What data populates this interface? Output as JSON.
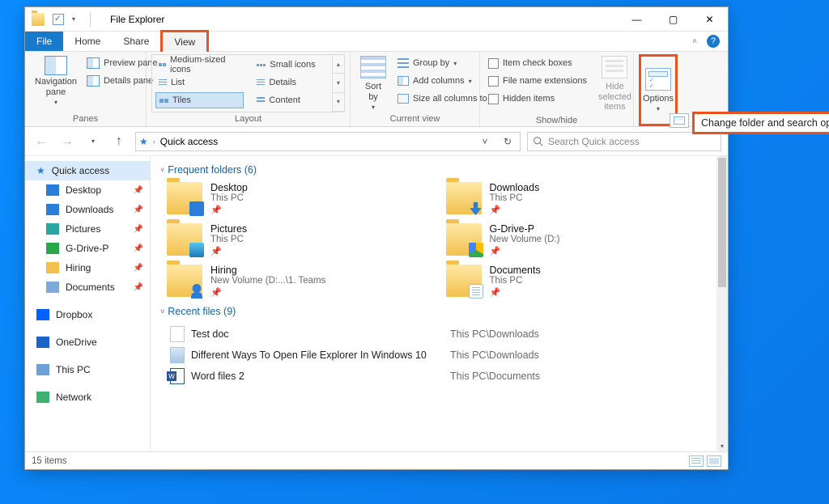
{
  "window": {
    "title": "File Explorer"
  },
  "win_controls": {
    "min": "—",
    "max": "▢",
    "close": "✕"
  },
  "tabs": {
    "file": "File",
    "home": "Home",
    "share": "Share",
    "view": "View"
  },
  "ribbon": {
    "panes": {
      "nav": "Navigation\npane",
      "preview": "Preview pane",
      "details": "Details pane",
      "label": "Panes"
    },
    "layout": {
      "medium": "Medium-sized icons",
      "small": "Small icons",
      "list": "List",
      "details": "Details",
      "tiles": "Tiles",
      "content": "Content",
      "label": "Layout"
    },
    "curview": {
      "sort": "Sort\nby",
      "group": "Group by",
      "addcols": "Add columns",
      "sizecols": "Size all columns to fit",
      "label": "Current view"
    },
    "showhide": {
      "checkboxes": "Item check boxes",
      "ext": "File name extensions",
      "hidden": "Hidden items",
      "hidebtn": "Hide selected\nitems",
      "label": "Show/hide"
    },
    "options": "Options"
  },
  "callout": "Change folder and search options",
  "address": {
    "crumb": "Quick access"
  },
  "search": {
    "placeholder": "Search Quick access"
  },
  "nav": {
    "quick": "Quick access",
    "desktop": "Desktop",
    "downloads": "Downloads",
    "pictures": "Pictures",
    "gdrive": "G-Drive-P",
    "hiring": "Hiring",
    "documents": "Documents",
    "dropbox": "Dropbox",
    "onedrive": "OneDrive",
    "thispc": "This PC",
    "network": "Network"
  },
  "sections": {
    "freq": "Frequent folders (6)",
    "recent": "Recent files (9)"
  },
  "freq": [
    {
      "name": "Desktop",
      "loc": "This PC",
      "ov": "desktop"
    },
    {
      "name": "Downloads",
      "loc": "This PC",
      "ov": "down"
    },
    {
      "name": "Pictures",
      "loc": "This PC",
      "ov": "pic"
    },
    {
      "name": "G-Drive-P",
      "loc": "New Volume (D:)",
      "ov": "gdrive"
    },
    {
      "name": "Hiring",
      "loc": "New Volume (D:...\\1. Teams",
      "ov": "person"
    },
    {
      "name": "Documents",
      "loc": "This PC",
      "ov": "doc"
    }
  ],
  "recent": [
    {
      "name": "Test doc",
      "loc": "This PC\\Downloads",
      "kind": "txt"
    },
    {
      "name": "Different Ways To Open File Explorer In Windows 10",
      "loc": "This PC\\Downloads",
      "kind": "img"
    },
    {
      "name": "Word files 2",
      "loc": "This PC\\Documents",
      "kind": "word"
    }
  ],
  "status": {
    "items": "15 items"
  }
}
